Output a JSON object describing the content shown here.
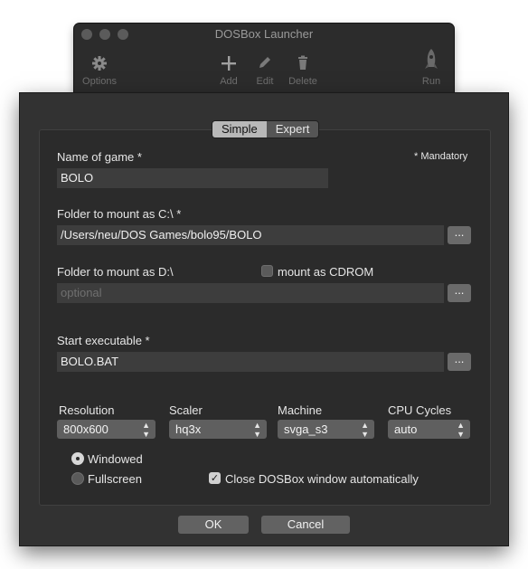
{
  "launcher": {
    "title": "DOSBox Launcher",
    "toolbar": [
      {
        "label": "Options",
        "icon": "gear-icon"
      },
      {
        "label": "Add",
        "icon": "plus-icon"
      },
      {
        "label": "Edit",
        "icon": "pencil-icon"
      },
      {
        "label": "Delete",
        "icon": "trash-icon"
      },
      {
        "label": "Run",
        "icon": "rocket-icon"
      }
    ]
  },
  "dialog": {
    "mode_tabs": {
      "simple": "Simple",
      "expert": "Expert",
      "selected": "Simple"
    },
    "mandatory_note": "* Mandatory",
    "name": {
      "label": "Name of game *",
      "value": "BOLO"
    },
    "folder_c": {
      "label": "Folder to mount as C:\\ *",
      "value": "/Users/neu/DOS Games/bolo95/BOLO",
      "browse": "..."
    },
    "folder_d": {
      "label": "Folder to mount as D:\\",
      "placeholder": "optional",
      "browse": "...",
      "cdrom_label": "mount as CDROM",
      "cdrom_checked": false
    },
    "executable": {
      "label": "Start executable *",
      "value": "BOLO.BAT",
      "browse": "..."
    },
    "resolution": {
      "label": "Resolution",
      "value": "800x600"
    },
    "scaler": {
      "label": "Scaler",
      "value": "hq3x"
    },
    "machine": {
      "label": "Machine",
      "value": "svga_s3"
    },
    "cpu_cycles": {
      "label": "CPU Cycles",
      "value": "auto"
    },
    "display_mode": {
      "windowed": "Windowed",
      "fullscreen": "Fullscreen",
      "selected": "Windowed"
    },
    "close_auto": {
      "label": "Close DOSBox window automatically",
      "checked": true
    },
    "ok": "OK",
    "cancel": "Cancel"
  },
  "colors": {
    "sheet_bg": "#323232",
    "panel_bg": "#2b2b2b",
    "field_bg": "#3d3d3d",
    "control_bg": "#5f5f5f"
  }
}
